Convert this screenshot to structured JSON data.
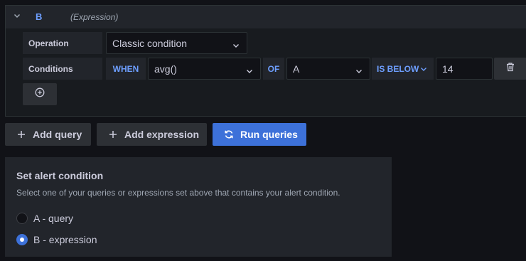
{
  "expression": {
    "ref_name": "B",
    "type_label": "(Expression)",
    "operation_label": "Operation",
    "operation_value": "Classic condition",
    "conditions_label": "Conditions",
    "condition": {
      "when_label": "WHEN",
      "reducer": "avg()",
      "of_label": "OF",
      "query": "A",
      "evaluator": "IS BELOW",
      "threshold": "14"
    }
  },
  "actions": {
    "add_query": "Add query",
    "add_expression": "Add expression",
    "run_queries": "Run queries"
  },
  "alert_condition": {
    "title": "Set alert condition",
    "description": "Select one of your queries or expressions set above that contains your alert condition.",
    "options": [
      {
        "label": "A - query",
        "checked": false
      },
      {
        "label": "B - expression",
        "checked": true
      }
    ]
  },
  "colors": {
    "accent": "#6e9fff",
    "primary": "#3d71d9",
    "background": "#111217",
    "panel": "#22252b"
  }
}
